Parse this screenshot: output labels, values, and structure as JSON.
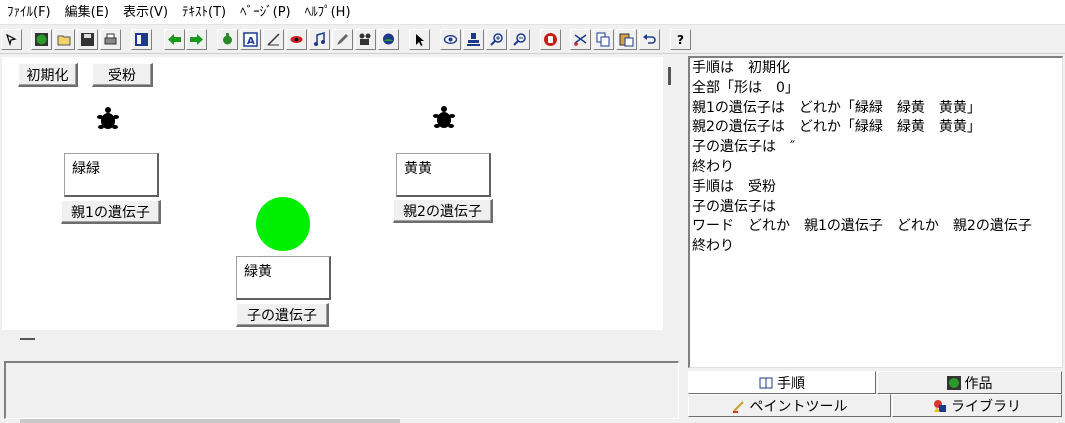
{
  "menu": [
    "ﾌｧｲﾙ(F)",
    "編集(E)",
    "表示(V)",
    "ﾃｷｽﾄ(T)",
    "ﾍﾞｰｼﾞ(P)",
    "ﾍﾙﾌﾟ(H)"
  ],
  "toolbar_icons": [
    "pointer-small-icon",
    "new-globe-icon",
    "open-folder-icon",
    "save-disk-icon",
    "print-icon",
    "page-layout-icon",
    "arrow-left-icon",
    "arrow-right-icon",
    "turtle-icon",
    "text-box-icon",
    "line-tool-icon",
    "eye-icon",
    "music-note-icon",
    "pencil-icon",
    "camera-icon",
    "world-icon",
    "cursor-icon",
    "look-icon",
    "stamp-icon",
    "zoom-in-icon",
    "zoom-out-icon",
    "stop-hand-icon",
    "cut-icon",
    "copy-icon",
    "paste-icon",
    "undo-icon",
    "help-icon"
  ],
  "stage": {
    "init_button": "初期化",
    "pollinate_button": "受粉",
    "parent1_value": "緑緑",
    "parent1_label": "親1の遺伝子",
    "parent2_value": "黄黄",
    "parent2_label": "親2の遺伝子",
    "child_value": "緑黄",
    "child_label": "子の遺伝子",
    "circle_color": "#00ee00"
  },
  "code_lines": [
    "手順は　初期化",
    "全部「形は　0」",
    "親1の遺伝子は　どれか「緑緑　緑黄　黄黄」",
    "親2の遺伝子は　どれか「緑緑　緑黄　黄黄」",
    "子の遺伝子は　″",
    "終わり",
    "手順は　受粉",
    "子の遺伝子は",
    "ワード　どれか　親1の遺伝子　どれか　親2の遺伝子",
    "終わり"
  ],
  "tabs": {
    "procedure": "手順",
    "work": "作品",
    "paint_tool": "ペイントツール",
    "library": "ライブラリ"
  }
}
